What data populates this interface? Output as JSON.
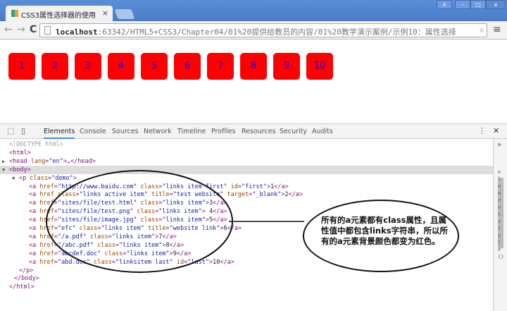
{
  "browser": {
    "tab_title": "CSS3属性选择器的使用",
    "url_host": "localhost",
    "url_rest": ":63342/HTML5+CSS3/Chapter04/01%20提供给教员的内容/01%20教学演示案例/示例10：属性选择"
  },
  "page": {
    "boxes": [
      "1",
      "2",
      "3",
      "4",
      "5",
      "6",
      "7",
      "8",
      "9",
      "10"
    ],
    "box_color": "#ff0000",
    "text_color": "#0000ff"
  },
  "devtools": {
    "tabs": [
      "Elements",
      "Console",
      "Sources",
      "Network",
      "Timeline",
      "Profiles",
      "Resources",
      "Security",
      "Audits"
    ],
    "sidebar_text": "element.style{}",
    "lines": [
      {
        "i": 0,
        "t": [
          [
            "dim",
            "<!DOCTYPE html>"
          ]
        ]
      },
      {
        "i": 0,
        "t": [
          [
            "tag",
            "<html>"
          ]
        ]
      },
      {
        "i": 0,
        "a": "▶",
        "t": [
          [
            "tag",
            "<head "
          ],
          [
            "attr",
            "lang"
          ],
          [
            "tag",
            "="
          ],
          [
            "val",
            "\"en\""
          ],
          [
            "tag",
            ">…</head>"
          ]
        ]
      },
      {
        "i": 0,
        "a": "▼",
        "hl": true,
        "t": [
          [
            "tag",
            "<body>"
          ]
        ]
      },
      {
        "i": 1,
        "a": "▼",
        "t": [
          [
            "tag",
            "<p "
          ],
          [
            "attr",
            "class"
          ],
          [
            "tag",
            "="
          ],
          [
            "val",
            "\"demo\""
          ],
          [
            "tag",
            ">"
          ]
        ]
      },
      {
        "i": 2,
        "t": [
          [
            "tag",
            "<a "
          ],
          [
            "attr",
            "href"
          ],
          [
            "tag",
            "="
          ],
          [
            "val",
            "\"http://www.baidu.com\""
          ],
          [
            "attr",
            " class"
          ],
          [
            "tag",
            "="
          ],
          [
            "val",
            "\"links item first\""
          ],
          [
            "attr",
            " id"
          ],
          [
            "tag",
            "="
          ],
          [
            "val",
            "\"first\""
          ],
          [
            "tag",
            ">"
          ],
          [
            "text",
            "1"
          ],
          [
            "tag",
            "</a>"
          ]
        ]
      },
      {
        "i": 2,
        "t": [
          [
            "tag",
            "<a "
          ],
          [
            "attr",
            "href class"
          ],
          [
            "tag",
            "="
          ],
          [
            "val",
            "\"links active item\""
          ],
          [
            "attr",
            " title"
          ],
          [
            "tag",
            "="
          ],
          [
            "val",
            "\"test website\""
          ],
          [
            "attr",
            " target"
          ],
          [
            "tag",
            "="
          ],
          [
            "val",
            "\"_blank\""
          ],
          [
            "tag",
            ">"
          ],
          [
            "text",
            "2"
          ],
          [
            "tag",
            "</a>"
          ]
        ]
      },
      {
        "i": 2,
        "t": [
          [
            "tag",
            "<a "
          ],
          [
            "attr",
            "href"
          ],
          [
            "tag",
            "="
          ],
          [
            "val",
            "\"sites/file/test.html\""
          ],
          [
            "attr",
            " class"
          ],
          [
            "tag",
            "="
          ],
          [
            "val",
            "\"links item\""
          ],
          [
            "tag",
            ">"
          ],
          [
            "text",
            "3"
          ],
          [
            "tag",
            "</a>"
          ]
        ]
      },
      {
        "i": 2,
        "t": [
          [
            "tag",
            "<a "
          ],
          [
            "attr",
            "href"
          ],
          [
            "tag",
            "="
          ],
          [
            "val",
            "\"sites/file/test.png\""
          ],
          [
            "attr",
            " class"
          ],
          [
            "tag",
            "="
          ],
          [
            "val",
            "\"links item\""
          ],
          [
            "tag",
            "> "
          ],
          [
            "text",
            "4"
          ],
          [
            "tag",
            "</a>"
          ]
        ]
      },
      {
        "i": 2,
        "t": [
          [
            "tag",
            "<a "
          ],
          [
            "attr",
            "href"
          ],
          [
            "tag",
            "="
          ],
          [
            "val",
            "\"sites/file/image.jpg\""
          ],
          [
            "attr",
            " class"
          ],
          [
            "tag",
            "="
          ],
          [
            "val",
            "\"links item\""
          ],
          [
            "tag",
            ">"
          ],
          [
            "text",
            "5"
          ],
          [
            "tag",
            "</a>"
          ]
        ]
      },
      {
        "i": 2,
        "t": [
          [
            "tag",
            "<a "
          ],
          [
            "attr",
            "href"
          ],
          [
            "tag",
            "="
          ],
          [
            "val",
            "\"efc\""
          ],
          [
            "attr",
            " class"
          ],
          [
            "tag",
            "="
          ],
          [
            "val",
            "\"links item\""
          ],
          [
            "attr",
            " title"
          ],
          [
            "tag",
            "="
          ],
          [
            "val",
            "\"website link\""
          ],
          [
            "tag",
            ">"
          ],
          [
            "text",
            "6"
          ],
          [
            "tag",
            "</a>"
          ]
        ]
      },
      {
        "i": 2,
        "t": [
          [
            "tag",
            "<a "
          ],
          [
            "attr",
            "href"
          ],
          [
            "tag",
            "="
          ],
          [
            "val",
            "\"/a.pdf\""
          ],
          [
            "attr",
            " class"
          ],
          [
            "tag",
            "="
          ],
          [
            "val",
            "\"links item\""
          ],
          [
            "tag",
            ">"
          ],
          [
            "text",
            "7"
          ],
          [
            "tag",
            "</a>"
          ]
        ]
      },
      {
        "i": 2,
        "t": [
          [
            "tag",
            "<a "
          ],
          [
            "attr",
            "href"
          ],
          [
            "tag",
            "="
          ],
          [
            "val",
            "\"/abc.pdf\""
          ],
          [
            "attr",
            " class"
          ],
          [
            "tag",
            "="
          ],
          [
            "val",
            "\"links item\""
          ],
          [
            "tag",
            ">"
          ],
          [
            "text",
            "8"
          ],
          [
            "tag",
            "</a>"
          ]
        ]
      },
      {
        "i": 2,
        "t": [
          [
            "tag",
            "<a "
          ],
          [
            "attr",
            "href"
          ],
          [
            "tag",
            "="
          ],
          [
            "val",
            "\"abcdef.doc\""
          ],
          [
            "attr",
            " class"
          ],
          [
            "tag",
            "="
          ],
          [
            "val",
            "\"links item\""
          ],
          [
            "tag",
            ">"
          ],
          [
            "text",
            "9"
          ],
          [
            "tag",
            "</a>"
          ]
        ]
      },
      {
        "i": 2,
        "t": [
          [
            "tag",
            "<a "
          ],
          [
            "attr",
            "href"
          ],
          [
            "tag",
            "="
          ],
          [
            "val",
            "\"abd.doc\""
          ],
          [
            "attr",
            " class"
          ],
          [
            "tag",
            "="
          ],
          [
            "val",
            "\"linksitem last\""
          ],
          [
            "attr",
            " id"
          ],
          [
            "tag",
            "="
          ],
          [
            "val",
            "\"last\""
          ],
          [
            "tag",
            ">"
          ],
          [
            "text",
            "10"
          ],
          [
            "tag",
            "</a>"
          ]
        ]
      },
      {
        "i": 1,
        "t": [
          [
            "tag",
            "</p>"
          ]
        ]
      },
      {
        "i": 0.5,
        "t": [
          [
            "tag",
            "</body>"
          ]
        ]
      },
      {
        "i": 0,
        "t": [
          [
            "tag",
            "</html>"
          ]
        ]
      }
    ]
  },
  "annotation": {
    "text": "所有的a元素都有class属性，且属性值中都包含links字符串，所以所有的a元素背景颜色都变为红色。"
  }
}
